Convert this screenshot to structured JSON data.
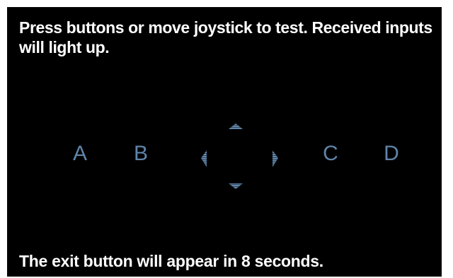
{
  "instructions": {
    "text": "Press buttons or move joystick to test. Received inputs will light up."
  },
  "buttons": {
    "a": "A",
    "b": "B",
    "c": "C",
    "d": "D"
  },
  "joystick": {
    "directions": [
      "up",
      "down",
      "left",
      "right"
    ],
    "icons": [
      "joystick-up-icon",
      "joystick-down-icon",
      "joystick-left-icon",
      "joystick-right-icon"
    ],
    "inactive_color": "#5f84a8"
  },
  "footer": {
    "exit_message": "The exit button will appear in 8 seconds."
  },
  "colors": {
    "background": "#000000",
    "text": "#ffffff",
    "indicator_inactive": "#5f84a8"
  }
}
